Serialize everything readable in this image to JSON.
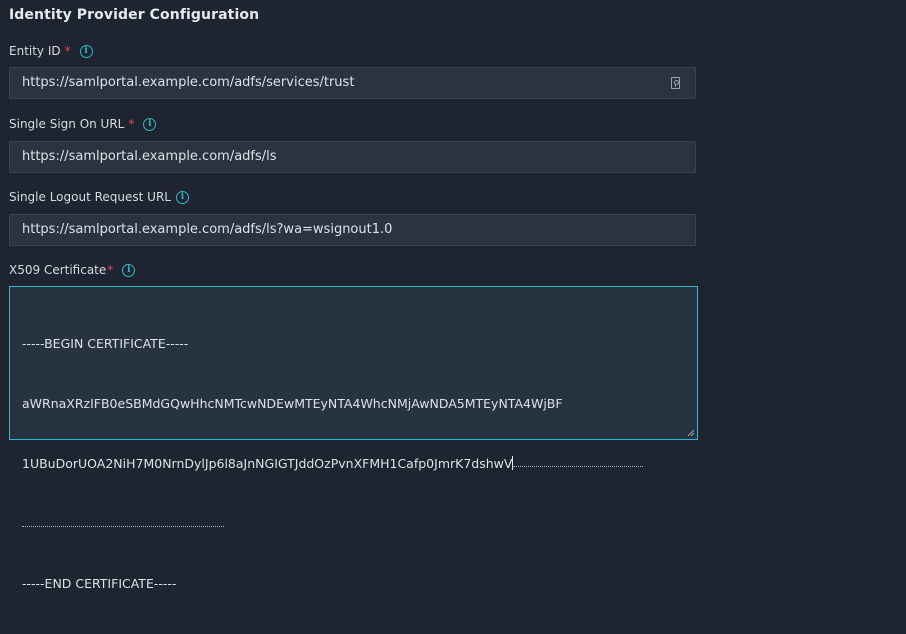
{
  "section": {
    "title": "Identity Provider Configuration"
  },
  "entity_id": {
    "label": "Entity ID",
    "required_mark": "*",
    "value": "https://samlportal.example.com/adfs/services/trust",
    "info_icon": "info-icon",
    "trailing_icon": "key-icon"
  },
  "sso_url": {
    "label": "Single Sign On URL",
    "required_mark": "*",
    "value": "https://samlportal.example.com/adfs/ls",
    "info_icon": "info-icon"
  },
  "slo_url": {
    "label": "Single Logout Request URL",
    "value": "https://samlportal.example.com/adfs/ls?wa=wsignout1.0",
    "info_icon": "info-icon"
  },
  "x509": {
    "label": "X509 Certificate",
    "required_mark": "*",
    "info_icon": "info-icon",
    "lines": [
      "-----BEGIN CERTIFICATE-----",
      "aWRnaXRzIFB0eSBMdGQwHhcNMTcwNDEwMTEyNTA4WhcNMjAwNDA5MTEyNTA4WjBF",
      "1UBuDorUOA2NiH7M0NrnDylJp6l8aJnNGIGTJddOzPvnXFMH1Cafp0JmrK7dshwV",
      "",
      "-----END CERTIFICATE-----"
    ]
  },
  "colors": {
    "background": "#1e2430",
    "input_bg": "#2c3340",
    "accent": "#2fb8c9",
    "required": "#e0485a"
  }
}
